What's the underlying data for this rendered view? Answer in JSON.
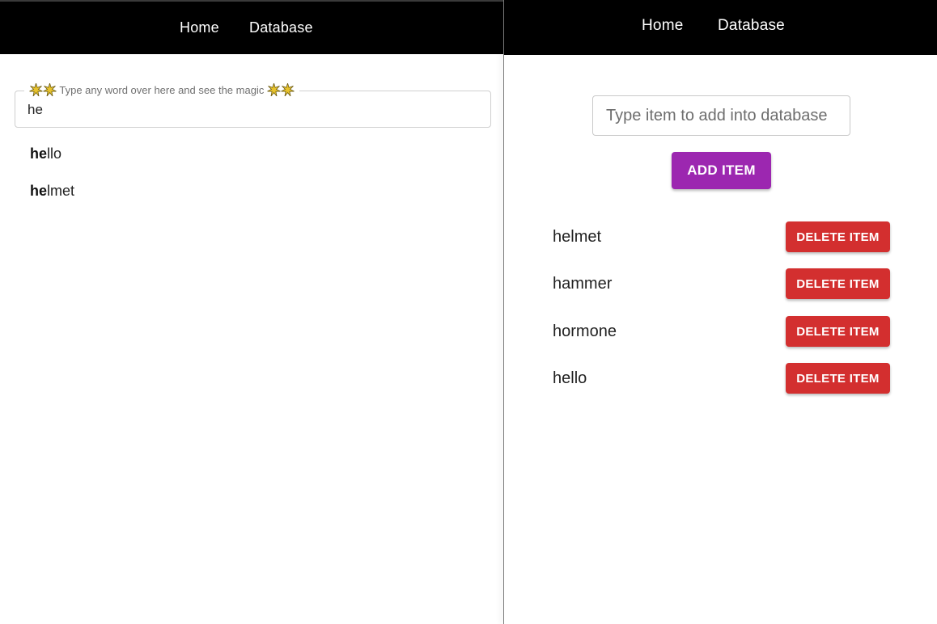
{
  "left_pane": {
    "nav": {
      "home_label": "Home",
      "database_label": "Database"
    },
    "search": {
      "label": "Type any word over here and see the magic",
      "label_icon": "sparkle-icon",
      "value": "he"
    },
    "suggestions": [
      {
        "match": "he",
        "rest": "llo"
      },
      {
        "match": "he",
        "rest": "lmet"
      }
    ]
  },
  "right_pane": {
    "nav": {
      "home_label": "Home",
      "database_label": "Database"
    },
    "item_input": {
      "placeholder": "Type item to add into database",
      "value": ""
    },
    "add_button_label": "ADD ITEM",
    "items": [
      {
        "label": "helmet",
        "delete_label": "DELETE ITEM"
      },
      {
        "label": "hammer",
        "delete_label": "DELETE ITEM"
      },
      {
        "label": "hormone",
        "delete_label": "DELETE ITEM"
      },
      {
        "label": "hello",
        "delete_label": "DELETE ITEM"
      }
    ]
  },
  "colors": {
    "navbar": "#000000",
    "add_button": "#9c27b0",
    "delete_button": "#d32f2f"
  }
}
